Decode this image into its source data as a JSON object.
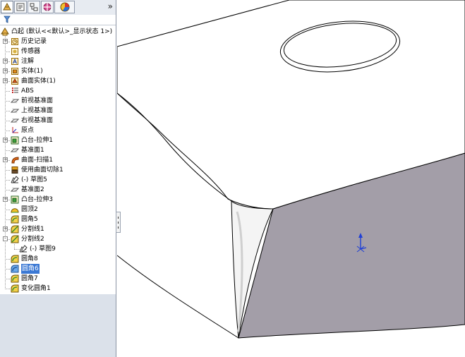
{
  "tabs": [
    "feature-manager",
    "property-manager",
    "configuration-manager",
    "dimxpert-manager",
    "display-manager"
  ],
  "more_glyph": "»",
  "tree": [
    {
      "name": "tree-root",
      "label": "凸起 (默认<<默认>_显示状态 1>)",
      "icon": "part-icon",
      "expand": "",
      "indent": 0
    },
    {
      "name": "history",
      "label": "历史记录",
      "icon": "history-icon",
      "expand": "+",
      "indent": 1
    },
    {
      "name": "sensors",
      "label": "传感器",
      "icon": "sensor-icon",
      "expand": "",
      "indent": 1
    },
    {
      "name": "annotations",
      "label": "注解",
      "icon": "annotation-icon",
      "expand": "+",
      "indent": 1
    },
    {
      "name": "solid-bodies",
      "label": "实体(1)",
      "icon": "solid-body-icon",
      "expand": "+",
      "indent": 1
    },
    {
      "name": "surface-bodies",
      "label": "曲面实体(1)",
      "icon": "surface-body-icon",
      "expand": "+",
      "indent": 1
    },
    {
      "name": "material",
      "label": "ABS",
      "icon": "material-icon",
      "expand": "",
      "indent": 1
    },
    {
      "name": "front-plane",
      "label": "前视基准面",
      "icon": "plane-icon",
      "expand": "",
      "indent": 1
    },
    {
      "name": "top-plane",
      "label": "上视基准面",
      "icon": "plane-icon",
      "expand": "",
      "indent": 1
    },
    {
      "name": "right-plane",
      "label": "右视基准面",
      "icon": "plane-icon",
      "expand": "",
      "indent": 1
    },
    {
      "name": "origin",
      "label": "原点",
      "icon": "origin-icon",
      "expand": "",
      "indent": 1
    },
    {
      "name": "boss-extrude-1",
      "label": "凸台-拉伸1",
      "icon": "boss-extrude-icon",
      "expand": "+",
      "indent": 1
    },
    {
      "name": "plane-1",
      "label": "基准面1",
      "icon": "plane-icon",
      "expand": "",
      "indent": 1
    },
    {
      "name": "surface-sweep-1",
      "label": "曲面-扫描1",
      "icon": "surface-sweep-icon",
      "expand": "+",
      "indent": 1
    },
    {
      "name": "surface-cut-1",
      "label": "使用曲面切除1",
      "icon": "surface-cut-icon",
      "expand": "",
      "indent": 1
    },
    {
      "name": "sketch-5",
      "label": "(-) 草图5",
      "icon": "sketch-icon",
      "expand": "",
      "indent": 1
    },
    {
      "name": "plane-2",
      "label": "基准面2",
      "icon": "plane-icon",
      "expand": "",
      "indent": 1
    },
    {
      "name": "boss-extrude-3",
      "label": "凸台-拉伸3",
      "icon": "boss-extrude-icon",
      "expand": "+",
      "indent": 1
    },
    {
      "name": "dome-2",
      "label": "圆顶2",
      "icon": "dome-icon",
      "expand": "",
      "indent": 1
    },
    {
      "name": "fillet-5",
      "label": "圆角5",
      "icon": "fillet-icon",
      "expand": "",
      "indent": 1
    },
    {
      "name": "split-line-1",
      "label": "分割线1",
      "icon": "split-line-icon",
      "expand": "+",
      "indent": 1
    },
    {
      "name": "split-line-2",
      "label": "分割线2",
      "icon": "split-line-icon",
      "expand": "-",
      "indent": 1
    },
    {
      "name": "sketch-9",
      "label": "(-) 草图9",
      "icon": "sketch-icon",
      "expand": "",
      "indent": 2
    },
    {
      "name": "fillet-8",
      "label": "圆角8",
      "icon": "fillet-icon",
      "expand": "",
      "indent": 1
    },
    {
      "name": "fillet-6",
      "label": "圆角6",
      "icon": "fillet-icon-selected",
      "expand": "",
      "indent": 1,
      "selected": true
    },
    {
      "name": "fillet-7",
      "label": "圆角7",
      "icon": "fillet-icon",
      "expand": "",
      "indent": 1
    },
    {
      "name": "variable-fillet-1",
      "label": "变化圆角1",
      "icon": "fillet-icon",
      "expand": "",
      "indent": 1
    }
  ],
  "colors": {
    "selection": "#3a78d4",
    "face_gray": "#a39ea8",
    "triad_blue": "#1f3fd6"
  }
}
